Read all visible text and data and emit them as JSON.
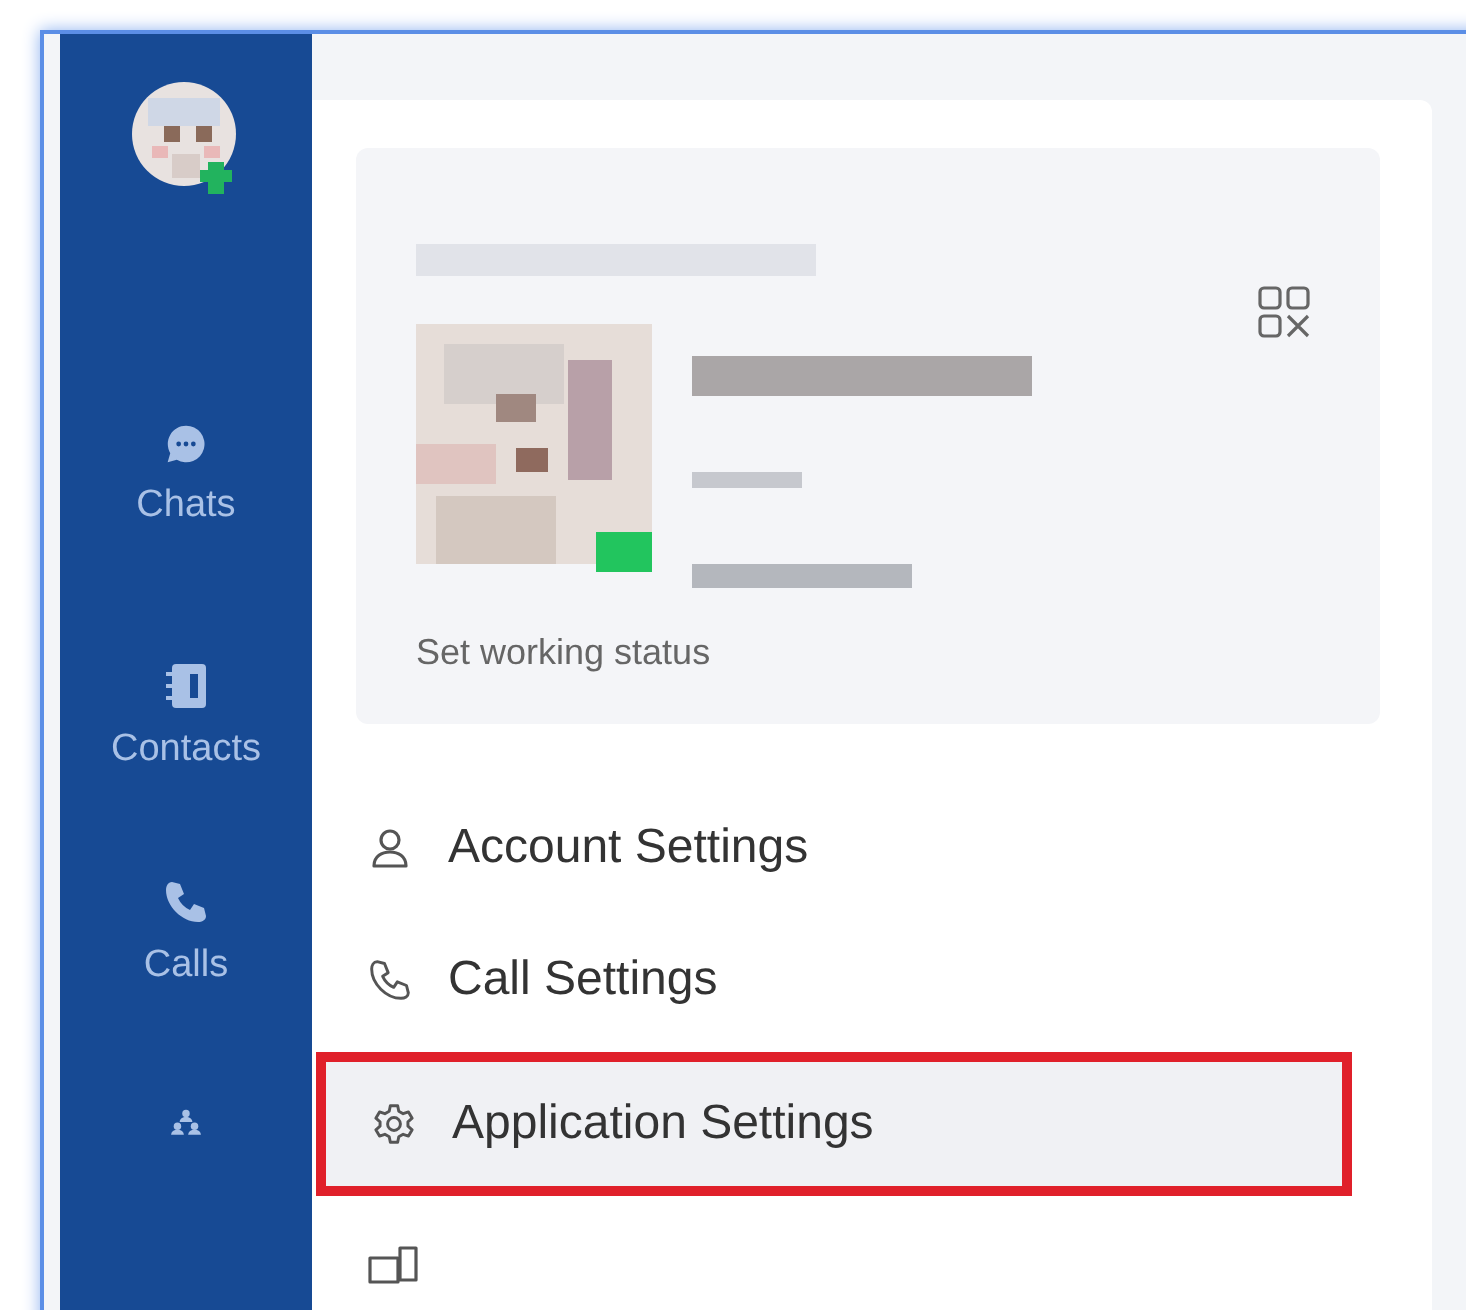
{
  "sidebar": {
    "items": [
      {
        "kind": "avatar"
      },
      {
        "kind": "chats",
        "label": "Chats"
      },
      {
        "kind": "contacts",
        "label": "Contacts"
      },
      {
        "kind": "calls",
        "label": "Calls"
      },
      {
        "kind": "meetings"
      }
    ]
  },
  "profile": {
    "online": true,
    "status_link": "Set working status"
  },
  "menu": [
    {
      "kind": "account",
      "label": "Account Settings",
      "selected": false
    },
    {
      "kind": "call",
      "label": "Call Settings",
      "selected": false
    },
    {
      "kind": "application",
      "label": "Application Settings",
      "selected": true
    },
    {
      "kind": "devices",
      "selected": false
    }
  ]
}
